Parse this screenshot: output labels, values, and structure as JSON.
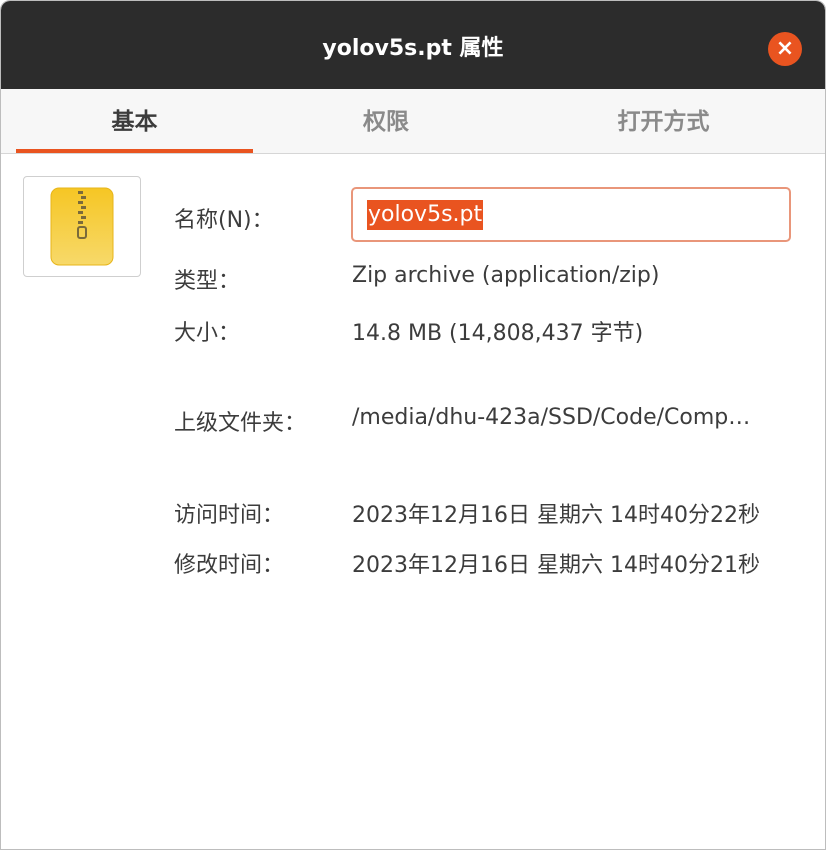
{
  "window": {
    "title": "yolov5s.pt 属性",
    "close_icon": "×"
  },
  "tabs": [
    {
      "label": "基本",
      "active": true
    },
    {
      "label": "权限",
      "active": false
    },
    {
      "label": "打开方式",
      "active": false
    }
  ],
  "file_icon": "zip-archive-icon",
  "fields": {
    "name_label": "名称(N)：",
    "name_value": "yolov5s.pt",
    "type_label": "类型：",
    "type_value": "Zip archive (application/zip)",
    "size_label": "大小：",
    "size_value": "14.8 MB (14,808,437 字节)",
    "parent_label": "上级文件夹：",
    "parent_value": "/media/dhu-423a/SSD/Code/Comp…",
    "accessed_label": "访问时间：",
    "accessed_value": "2023年12月16日 星期六 14时40分22秒",
    "modified_label": "修改时间：",
    "modified_value": "2023年12月16日 星期六 14时40分21秒"
  },
  "colors": {
    "accent": "#e95420",
    "titlebar": "#2c2c2c"
  }
}
